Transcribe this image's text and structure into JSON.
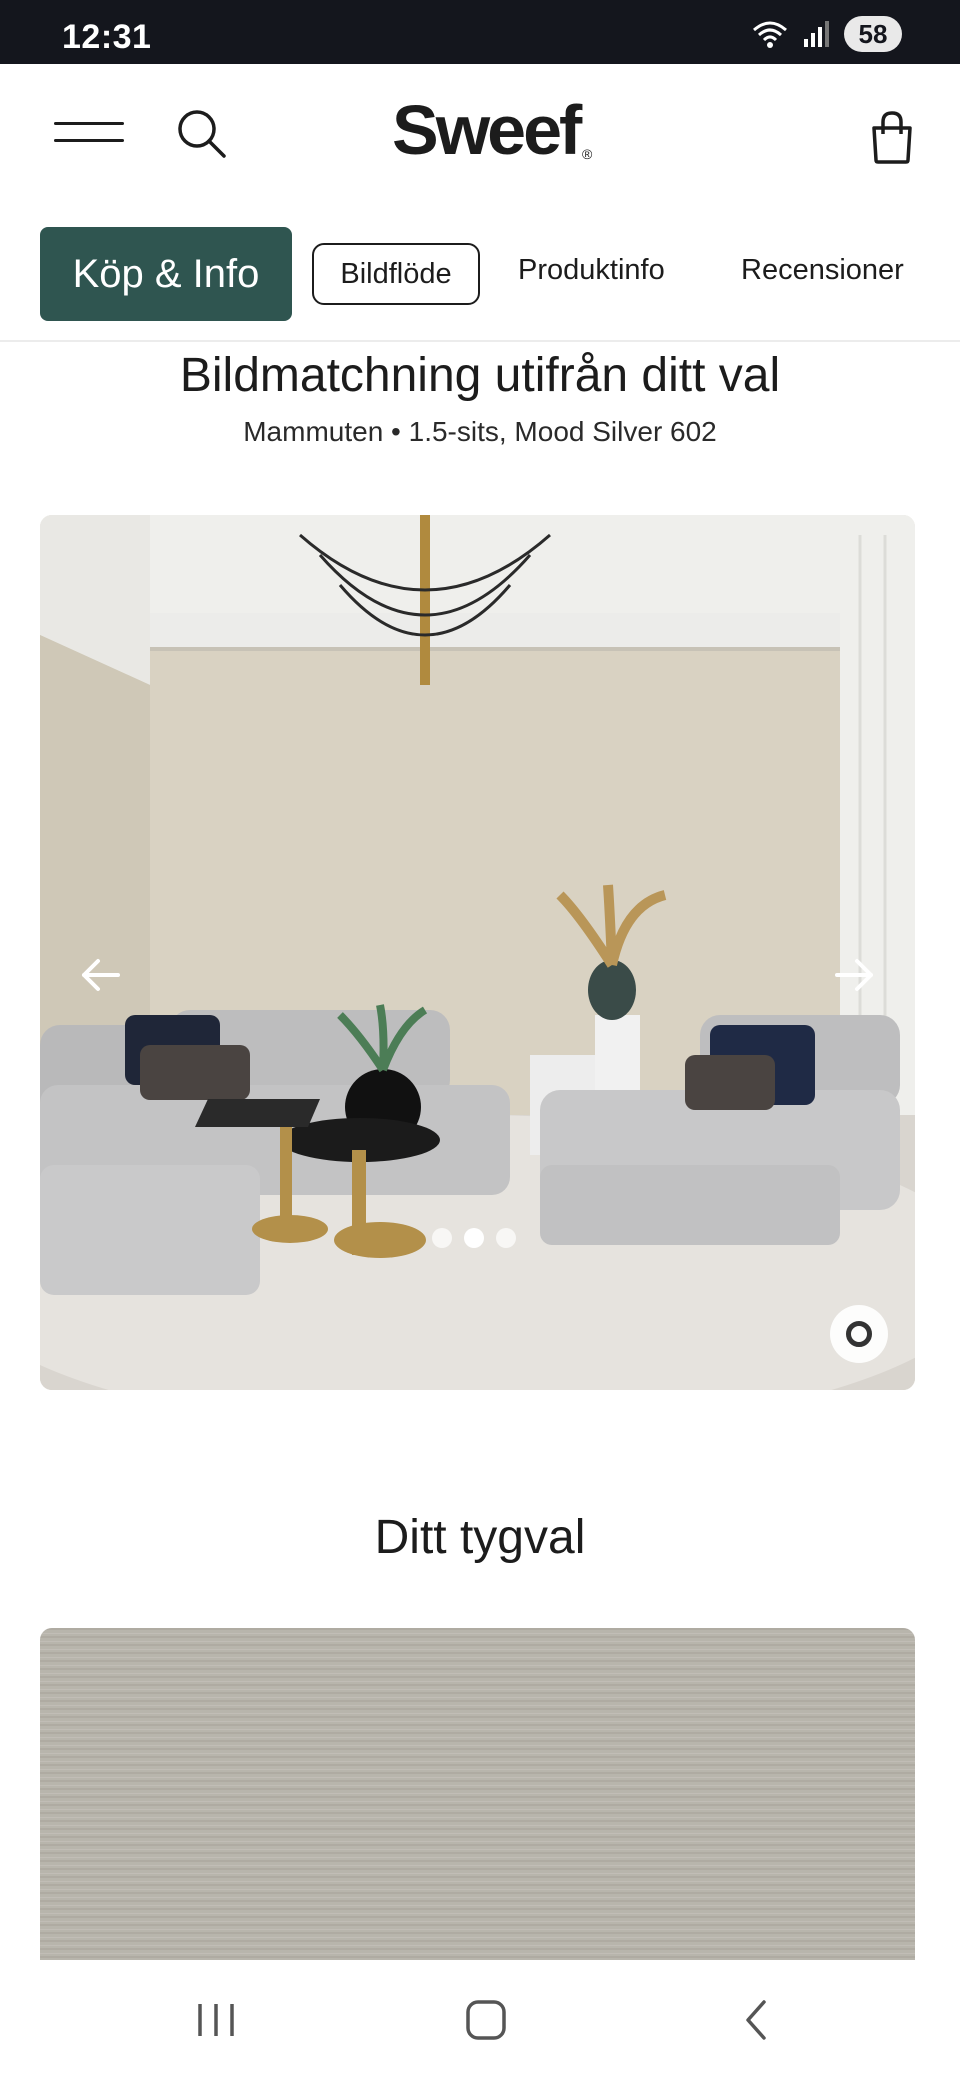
{
  "status_bar": {
    "time": "12:31",
    "battery": "58",
    "icons": [
      "wifi-icon",
      "signal-icon",
      "battery-icon"
    ]
  },
  "header": {
    "logo": "Sweef",
    "logo_mark": "®",
    "icons": [
      "menu-icon",
      "search-icon",
      "cart-icon"
    ]
  },
  "tabs": [
    {
      "label": "Köp & Info",
      "style": "primary"
    },
    {
      "label": "Bildflöde",
      "style": "outline"
    },
    {
      "label": "Produktinfo",
      "style": "plain"
    },
    {
      "label": "Recensioner",
      "style": "plain"
    }
  ],
  "image_match": {
    "title": "Bildmatchning utifrån ditt val",
    "subtitle": "Mammuten • 1.5-sits, Mood Silver 602",
    "carousel": {
      "slides": 3,
      "active": 1
    }
  },
  "fabric": {
    "title": "Ditt tygval"
  },
  "colors": {
    "accent": "#2f5550",
    "status_bar": "#14161d",
    "text": "#1c1c1c"
  }
}
